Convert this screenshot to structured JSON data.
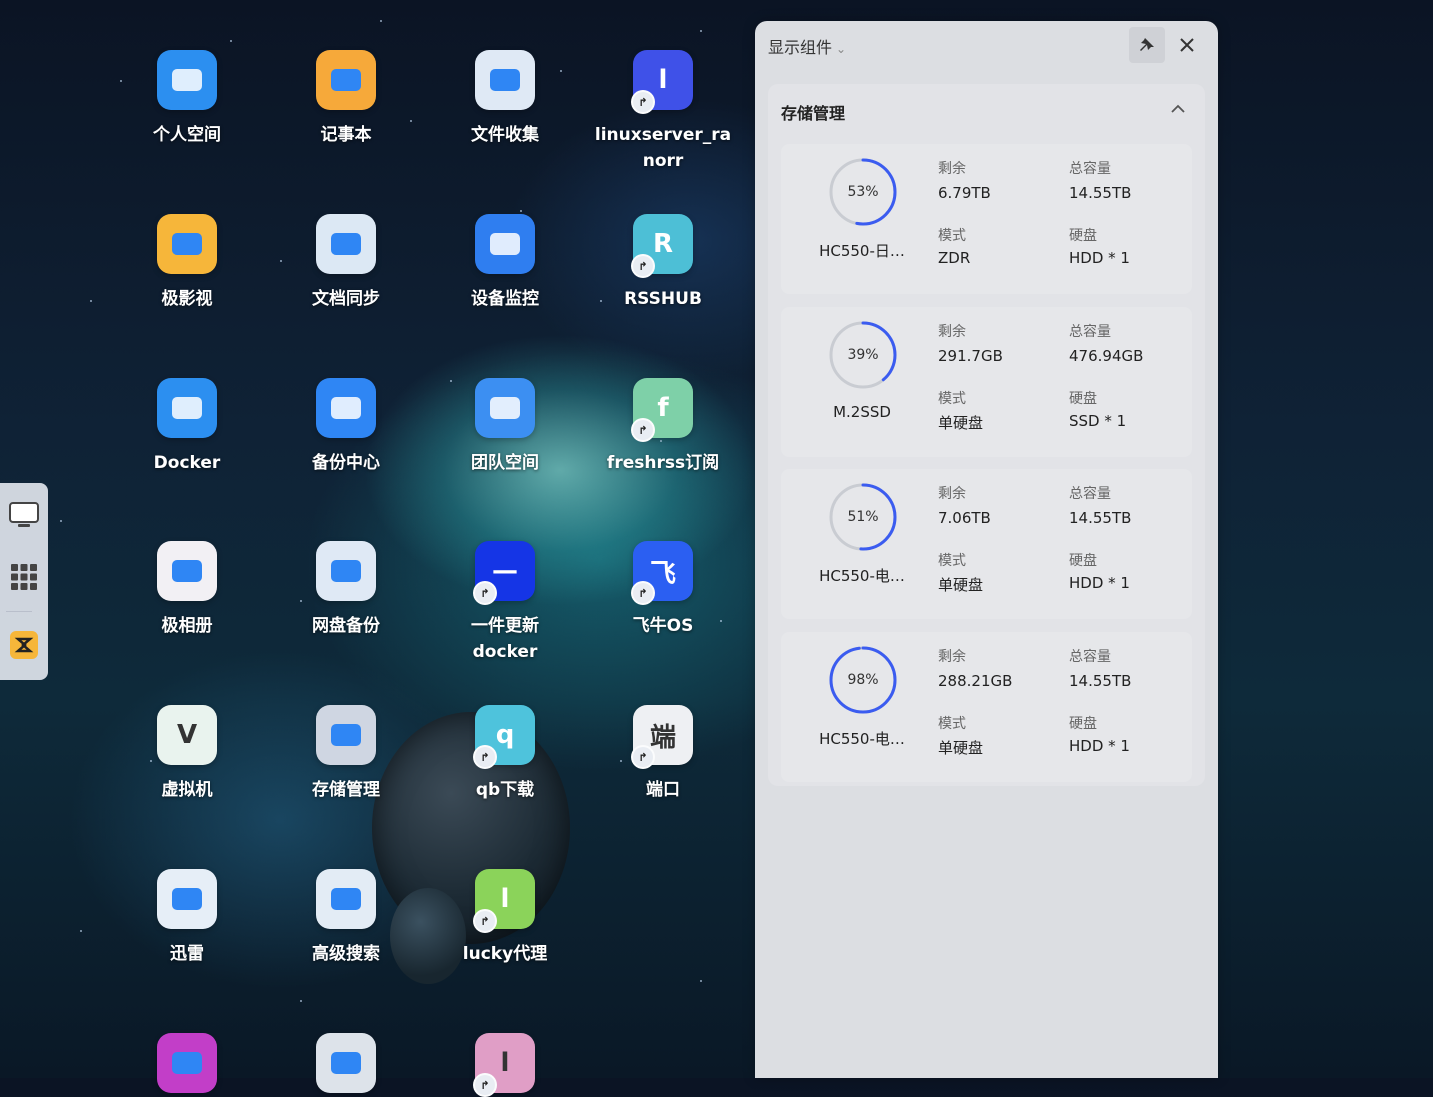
{
  "apps": [
    {
      "label": "个人空间",
      "icon": "folder-icon",
      "color": "#2c8ff0",
      "glyph": "",
      "docker": false
    },
    {
      "label": "记事本",
      "icon": "notepad-icon",
      "color": "#f6a93a",
      "glyph": "",
      "docker": false
    },
    {
      "label": "文件收集",
      "icon": "file-collect-icon",
      "color": "#dfe9f5",
      "glyph": "",
      "docker": false
    },
    {
      "label": "linuxserver_ra\nnorr",
      "icon": "letter-l-icon",
      "color": "#3f51e8",
      "glyph": "l",
      "docker": true
    },
    {
      "label": "极影视",
      "icon": "video-icon",
      "color": "#f6b63a",
      "glyph": "",
      "docker": false
    },
    {
      "label": "文档同步",
      "icon": "sync-icon",
      "color": "#dce8f4",
      "glyph": "",
      "docker": false
    },
    {
      "label": "设备监控",
      "icon": "monitor-icon",
      "color": "#2f7ef0",
      "glyph": "",
      "docker": false
    },
    {
      "label": "RSSHUB",
      "icon": "letter-r-icon",
      "color": "#4dbfd6",
      "glyph": "R",
      "docker": true
    },
    {
      "label": "Docker",
      "icon": "docker-whale-icon",
      "color": "#2c8ff0",
      "glyph": "",
      "docker": false
    },
    {
      "label": "备份中心",
      "icon": "backup-icon",
      "color": "#2f86f4",
      "glyph": "",
      "docker": false
    },
    {
      "label": "团队空间",
      "icon": "team-folder-icon",
      "color": "#3c8ff2",
      "glyph": "",
      "docker": false
    },
    {
      "label": "freshrss订阅",
      "icon": "letter-f-icon",
      "color": "#7ed0a8",
      "glyph": "f",
      "docker": true
    },
    {
      "label": "极相册",
      "icon": "photos-icon",
      "color": "#f2f0f4",
      "glyph": "",
      "docker": false
    },
    {
      "label": "网盘备份",
      "icon": "cloud-backup-icon",
      "color": "#dfe9f5",
      "glyph": "",
      "docker": false
    },
    {
      "label": "一件更新\ndocker",
      "icon": "update-icon",
      "color": "#1535e6",
      "glyph": "—",
      "docker": true
    },
    {
      "label": "飞牛OS",
      "icon": "fnos-icon",
      "color": "#2b5ff2",
      "glyph": "飞",
      "docker": true
    },
    {
      "label": "虚拟机",
      "icon": "vm-icon",
      "color": "#e9f3ee",
      "glyph": "V",
      "docker": false
    },
    {
      "label": "存储管理",
      "icon": "storage-icon",
      "color": "#cfd6e2",
      "glyph": "",
      "docker": false
    },
    {
      "label": "qb下载",
      "icon": "letter-q-icon",
      "color": "#4ec3dc",
      "glyph": "q",
      "docker": true
    },
    {
      "label": "端口",
      "icon": "port-icon",
      "color": "#eef0f3",
      "glyph": "端",
      "docker": true
    },
    {
      "label": "迅雷",
      "icon": "thunder-icon",
      "color": "#e6eef7",
      "glyph": "",
      "docker": false
    },
    {
      "label": "高级搜索",
      "icon": "search-icon",
      "color": "#e3ecf5",
      "glyph": "",
      "docker": false
    },
    {
      "label": "lucky代理",
      "icon": "letter-l-icon",
      "color": "#8bd35a",
      "glyph": "l",
      "docker": true
    },
    {
      "label": "",
      "icon": "spacer",
      "color": "",
      "glyph": "",
      "docker": false
    },
    {
      "label": "",
      "icon": "music-icon",
      "color": "#c23ec8",
      "glyph": "",
      "docker": false
    },
    {
      "label": "",
      "icon": "settings-icon",
      "color": "#dde3ea",
      "glyph": "",
      "docker": false
    },
    {
      "label": "",
      "icon": "letter-l-icon",
      "color": "#e09ec6",
      "glyph": "l",
      "docker": true
    }
  ],
  "panel": {
    "title": "显示组件",
    "widget_title": "存储管理",
    "labels": {
      "free": "剩余",
      "total": "总容量",
      "mode": "模式",
      "disk": "硬盘"
    },
    "disks": [
      {
        "name": "HC550-日…",
        "percent": 53,
        "percent_text": "53%",
        "free": "6.79TB",
        "total": "14.55TB",
        "mode": "ZDR",
        "disk": "HDD * 1",
        "ring_color": "#3b5cf0"
      },
      {
        "name": "M.2SSD",
        "percent": 39,
        "percent_text": "39%",
        "free": "291.7GB",
        "total": "476.94GB",
        "mode": "单硬盘",
        "disk": "SSD * 1",
        "ring_color": "#3b5cf0"
      },
      {
        "name": "HC550-电…",
        "percent": 51,
        "percent_text": "51%",
        "free": "7.06TB",
        "total": "14.55TB",
        "mode": "单硬盘",
        "disk": "HDD * 1",
        "ring_color": "#3b5cf0"
      },
      {
        "name": "HC550-电…",
        "percent": 98,
        "percent_text": "98%",
        "free": "288.21GB",
        "total": "14.55TB",
        "mode": "单硬盘",
        "disk": "HDD * 1",
        "ring_color": "#3b5cf0"
      }
    ]
  }
}
